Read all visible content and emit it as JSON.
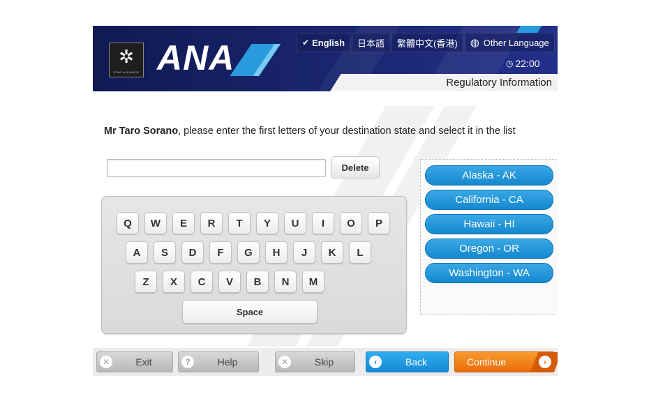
{
  "header": {
    "brand": "ANA",
    "logo_text": "STAR ALLIANCE",
    "languages": [
      {
        "label": "English",
        "active": true
      },
      {
        "label": "日本語",
        "active": false
      },
      {
        "label": "繁體中文(香港)",
        "active": false
      },
      {
        "label": "Other Language",
        "active": false
      }
    ],
    "clock": "22:00",
    "section_title": "Regulatory Information"
  },
  "main": {
    "instruction_name": "Mr Taro Sorano",
    "instruction_text": ", please enter the first letters of your destination state and select it in the list",
    "search_value": "",
    "delete_label": "Delete"
  },
  "keyboard": {
    "row1": [
      "Q",
      "W",
      "E",
      "R",
      "T",
      "Y",
      "U",
      "I",
      "O",
      "P"
    ],
    "row2": [
      "A",
      "S",
      "D",
      "F",
      "G",
      "H",
      "J",
      "K",
      "L"
    ],
    "row3": [
      "Z",
      "X",
      "C",
      "V",
      "B",
      "N",
      "M"
    ],
    "space_label": "Space"
  },
  "results": {
    "states": [
      "Alaska - AK",
      "California - CA",
      "Hawaii - HI",
      "Oregon - OR",
      "Washington - WA"
    ]
  },
  "footer": {
    "exit": "Exit",
    "help": "Help",
    "skip": "Skip",
    "back": "Back",
    "continue": "Continue"
  },
  "colors": {
    "header_navy": "#1a2670",
    "accent_blue": "#1689d4",
    "continue_orange": "#ea6d0c"
  }
}
